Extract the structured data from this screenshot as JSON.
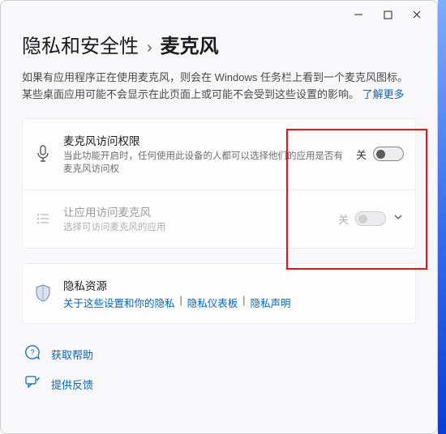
{
  "window": {
    "minimize_name": "minimize",
    "maximize_name": "maximize",
    "close_name": "close"
  },
  "breadcrumb": {
    "root": "隐私和安全性",
    "separator": "›",
    "current": "麦克风"
  },
  "description": {
    "text": "如果有应用程序正在使用麦克风，则会在 Windows 任务栏上看到一个麦克风图标。 某些桌面应用可能不会显示在此页面上或可能不会受到这些设置的影响。 ",
    "learn_more": "了解更多"
  },
  "rows": {
    "access": {
      "title": "麦克风访问权限",
      "subtitle": "当此功能开启时，任何使用此设备的人都可以选择他们的应用是否有麦克风访问权",
      "state_label": "关",
      "toggle_state": "off"
    },
    "apps": {
      "title": "让应用访问麦克风",
      "subtitle": "选择可访问麦克风的应用",
      "state_label": "关",
      "toggle_state": "off",
      "disabled": true
    },
    "privacy": {
      "title": "隐私资源",
      "links": [
        "关于这些设置和你的隐私",
        "隐私仪表板",
        "隐私声明"
      ],
      "link_separator": "|"
    }
  },
  "footer": {
    "help": "获取帮助",
    "feedback": "提供反馈"
  },
  "colors": {
    "accent": "#0067c0",
    "highlight_box": "#e11"
  }
}
